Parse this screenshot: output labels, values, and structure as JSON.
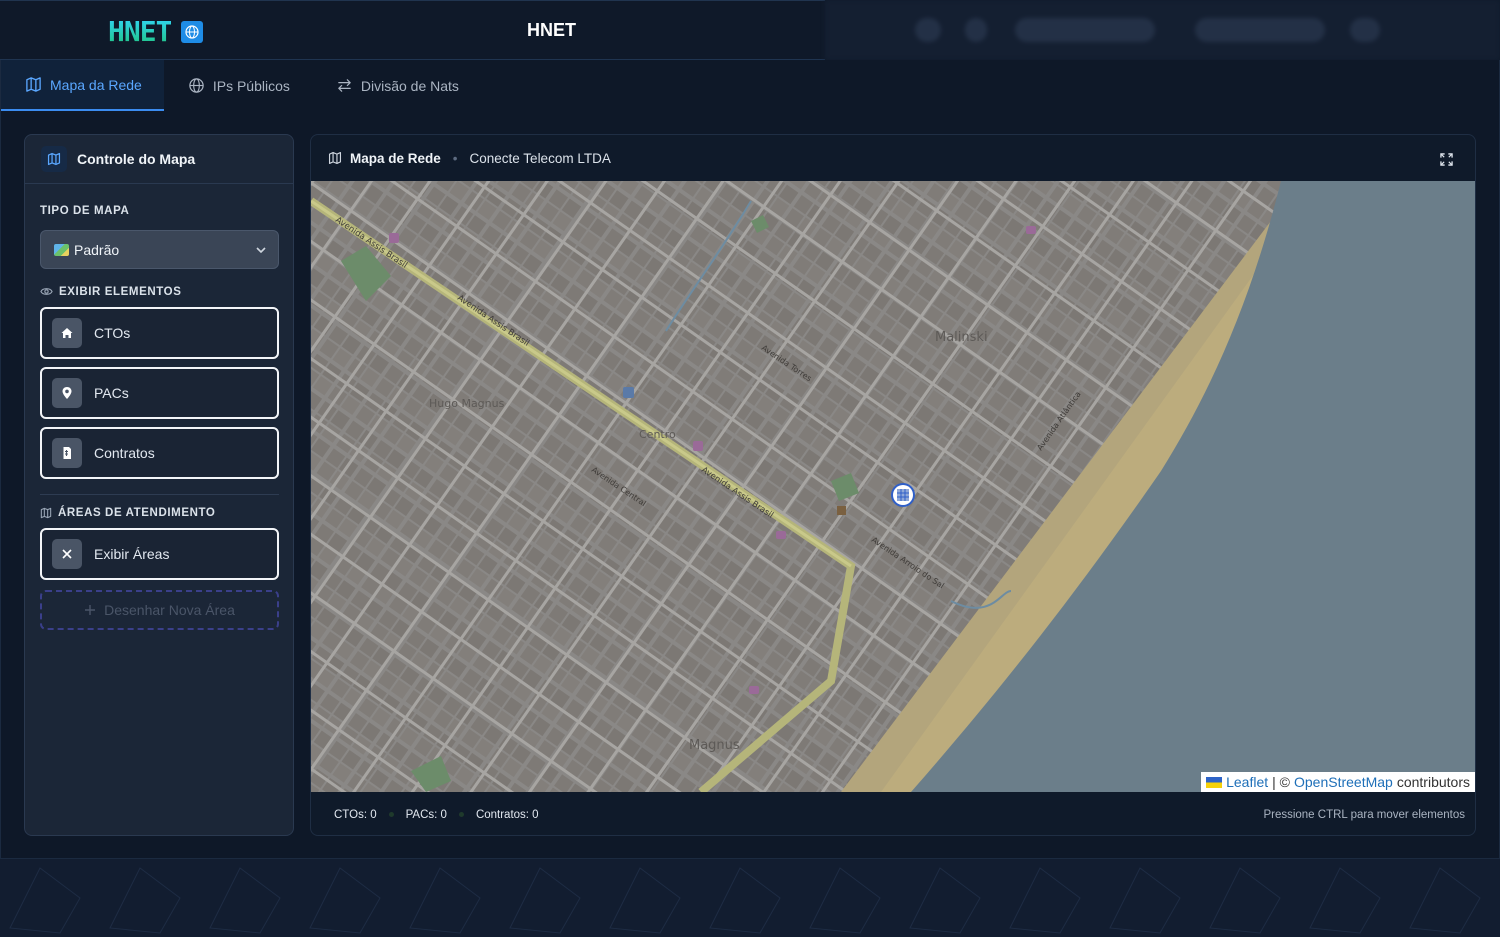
{
  "app": {
    "logo_text": "HNET",
    "title": "HNET"
  },
  "tabs": [
    {
      "label": "Mapa da Rede",
      "icon": "map-icon",
      "active": true
    },
    {
      "label": "IPs Públicos",
      "icon": "globe-icon",
      "active": false
    },
    {
      "label": "Divisão de Nats",
      "icon": "arrows-swap-icon",
      "active": false
    }
  ],
  "sidebar": {
    "title": "Controle do Mapa",
    "map_type_label": "TIPO DE MAPA",
    "map_type_value": "Padrão",
    "elements_label": "EXIBIR ELEMENTOS",
    "elements": [
      {
        "label": "CTOs",
        "icon": "home-icon"
      },
      {
        "label": "PACs",
        "icon": "map-pin-icon"
      },
      {
        "label": "Contratos",
        "icon": "document-icon"
      }
    ],
    "areas_label": "ÁREAS DE ATENDIMENTO",
    "show_areas_label": "Exibir Áreas",
    "draw_area_label": "Desenhar Nova Área"
  },
  "map_panel": {
    "title": "Mapa de Rede",
    "company": "Conecte Telecom LTDA",
    "labels": {
      "district_hugo": "Hugo Magnus",
      "district_centro": "Centro",
      "district_malinski": "Malinski",
      "district_magnus": "Magnus",
      "street_assis": "Avenida Assis Brasil",
      "street_central": "Avenida Central",
      "street_torres": "Avenida Torres",
      "street_atlantica": "Avenida Atlântica",
      "street_arroio": "Avenida Arroio do Sal"
    },
    "attribution": {
      "leaflet": "Leaflet",
      "separator": "| ©",
      "osm": "OpenStreetMap",
      "suffix": "contributors"
    }
  },
  "status": {
    "ctos": "CTOs: 0",
    "pacs": "PACs: 0",
    "contratos": "Contratos: 0",
    "hint": "Pressione CTRL para mover elementos"
  },
  "colors": {
    "accent": "#3b8cf0",
    "map_land": "#8a8886",
    "map_water": "#6a7d8a",
    "map_beach": "#b8a77a"
  }
}
